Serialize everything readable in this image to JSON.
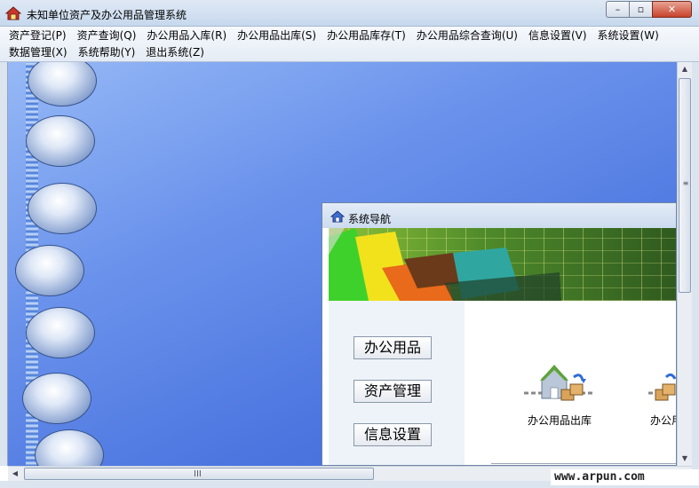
{
  "window": {
    "title": "未知单位资产及办公用品管理系统",
    "controls": {
      "minimize": "–",
      "maximize": "▫",
      "close": "✕"
    }
  },
  "menu": {
    "row1": [
      "资产登记(P)",
      "资产查询(Q)",
      "办公用品入库(R)",
      "办公用品出库(S)",
      "办公用品库存(T)",
      "办公用品综合查询(U)",
      "信息设置(V)",
      "系统设置(W)"
    ],
    "row2": [
      "数据管理(X)",
      "系统帮助(Y)",
      "退出系统(Z)"
    ]
  },
  "child_window": {
    "title": "系统导航",
    "nav_buttons": [
      "办公用品",
      "资产管理",
      "信息设置"
    ],
    "features": [
      "办公用品出库",
      "办公用"
    ]
  },
  "scrollbar": {
    "h_grip": "III",
    "v_grip": "≡"
  },
  "watermark": "www.arpun.com",
  "colors": {
    "workspace_blue": "#5a82e6",
    "titlebar": "#c7d8ed",
    "close_button": "#c7432b"
  }
}
